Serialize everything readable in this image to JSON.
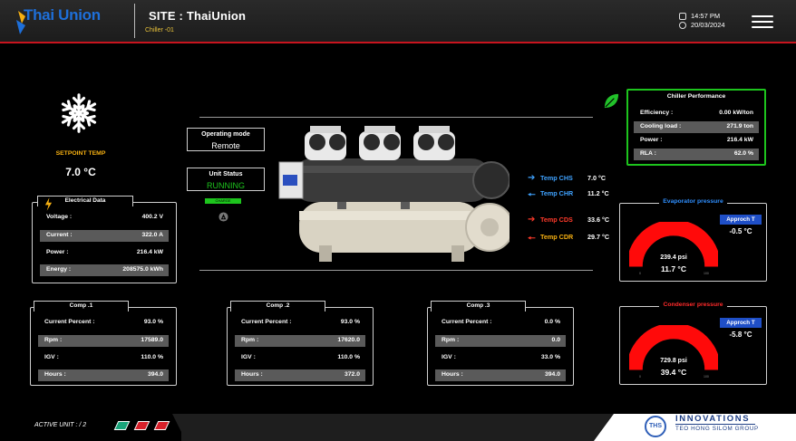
{
  "header": {
    "logo_text": "Thai Union",
    "site_title": "SITE : ThaiUnion",
    "chiller": "Chiller -01",
    "time": "14:57 PM",
    "date": "20/03/2024"
  },
  "setpoint": {
    "label": "SETPOINT TEMP",
    "value": "7.0 °C"
  },
  "electrical": {
    "title": "Electrical Data",
    "rows": [
      {
        "k": "Voltage :",
        "v": "400.2 V"
      },
      {
        "k": "Current :",
        "v": "322.0 A"
      },
      {
        "k": "Power :",
        "v": "216.4 kW"
      },
      {
        "k": "Energy :",
        "v": "208575.0 kWh"
      }
    ]
  },
  "operating_mode": {
    "label": "Operating mode",
    "value": "Remote"
  },
  "unit_status": {
    "label": "Unit Status",
    "value": "RUNNING",
    "badge": "CHARGE"
  },
  "temps": [
    {
      "label": "Temp CHS",
      "value": "7.0 °C",
      "color": "#3fa2ff"
    },
    {
      "label": "Temp CHR",
      "value": "11.2 °C",
      "color": "#3fa2ff"
    },
    {
      "label": "Temp CDS",
      "value": "33.6 °C",
      "color": "#ff3a2a"
    },
    {
      "label": "Temp CDR",
      "value": "29.7 °C",
      "color": "#f6b012"
    }
  ],
  "performance": {
    "title": "Chiller Performance",
    "rows": [
      {
        "k": "Efficiency :",
        "v": "0.00 kW/ton"
      },
      {
        "k": "Cooling load :",
        "v": "271.9 ton"
      },
      {
        "k": "Power :",
        "v": "216.4 kW"
      },
      {
        "k": "RLA :",
        "v": "62.0 %"
      }
    ]
  },
  "evaporator": {
    "title": "Evaporator pressure",
    "title_color": "#2f8fff",
    "approch_label": "Approch T",
    "approch_value": "-0.5 °C",
    "psi": "239.4 psi",
    "temp": "11.7 °C",
    "fraction": 1.0,
    "tick_min": "0",
    "tick_max": "100"
  },
  "condenser": {
    "title": "Condenser pressure",
    "title_color": "#ff2a2a",
    "approch_label": "Approch T",
    "approch_value": "-5.8 °C",
    "psi": "729.8 psi",
    "temp": "39.4 °C",
    "fraction": 1.0,
    "tick_min": "0",
    "tick_max": "100"
  },
  "comps": [
    {
      "title": "Comp .1",
      "rows": [
        {
          "k": "Current Percent :",
          "v": "93.0 %"
        },
        {
          "k": "Rpm :",
          "v": "17589.0"
        },
        {
          "k": "IGV :",
          "v": "110.0 %"
        },
        {
          "k": "Hours :",
          "v": "394.0"
        }
      ]
    },
    {
      "title": "Comp .2",
      "rows": [
        {
          "k": "Current Percent :",
          "v": "93.0 %"
        },
        {
          "k": "Rpm :",
          "v": "17620.0"
        },
        {
          "k": "IGV :",
          "v": "110.0 %"
        },
        {
          "k": "Hours :",
          "v": "372.0"
        }
      ]
    },
    {
      "title": "Comp .3",
      "rows": [
        {
          "k": "Current Percent :",
          "v": "0.0 %"
        },
        {
          "k": "Rpm :",
          "v": "0.0"
        },
        {
          "k": "IGV :",
          "v": "33.0 %"
        },
        {
          "k": "Hours :",
          "v": "394.0"
        }
      ]
    }
  ],
  "footer": {
    "active_unit": "ACTIVE UNIT : / 2",
    "unit_flags": [
      "#1aa37a",
      "#d8202a",
      "#d8202a"
    ],
    "brand_badge": "THS",
    "brand_name": "INNOVATIONS",
    "brand_group": "TEO HONG SILOM GROUP"
  },
  "colors": {
    "accent_red": "#c8141e",
    "panel_green": "#1dc41d",
    "gauge_red": "#ff0a0a"
  },
  "icons": [
    "snowflake-icon",
    "leaf-icon",
    "lightning-icon",
    "clock-icon",
    "calendar-icon",
    "menu-icon",
    "alarm-icon"
  ]
}
